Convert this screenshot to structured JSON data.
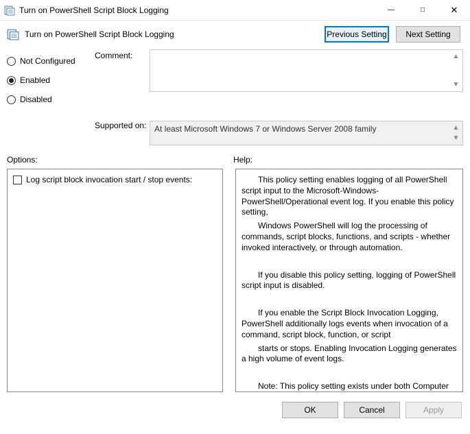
{
  "window": {
    "title": "Turn on PowerShell Script Block Logging"
  },
  "header": {
    "title": "Turn on PowerShell Script Block Logging",
    "prev": "Previous Setting",
    "next": "Next Setting"
  },
  "state": {
    "not_configured": "Not Configured",
    "enabled": "Enabled",
    "disabled": "Disabled",
    "selected": "enabled"
  },
  "labels": {
    "comment": "Comment:",
    "supported": "Supported on:",
    "options": "Options:",
    "help": "Help:"
  },
  "supported_text": "At least Microsoft Windows 7 or Windows Server 2008 family",
  "options": {
    "checkbox_label": "Log script block invocation start / stop events:"
  },
  "help": {
    "p1a": "This policy setting enables logging of all PowerShell script input to the Microsoft-Windows-PowerShell/Operational event log. If you enable this policy setting,",
    "p1b": "Windows PowerShell will log the processing of commands, script blocks, functions, and scripts - whether invoked interactively, or through automation.",
    "p2": "If you disable this policy setting, logging of PowerShell script input is disabled.",
    "p3a": "If you enable the Script Block Invocation Logging, PowerShell additionally logs events when invocation of a command, script block, function, or script",
    "p3b": "starts or stops. Enabling Invocation Logging generates a high volume of event logs.",
    "p4": "Note: This policy setting exists under both Computer Configuration and User Configuration in the Group Policy Editor. The Computer Configuration policy setting takes precedence over the User Configuration policy setting."
  },
  "footer": {
    "ok": "OK",
    "cancel": "Cancel",
    "apply": "Apply"
  }
}
